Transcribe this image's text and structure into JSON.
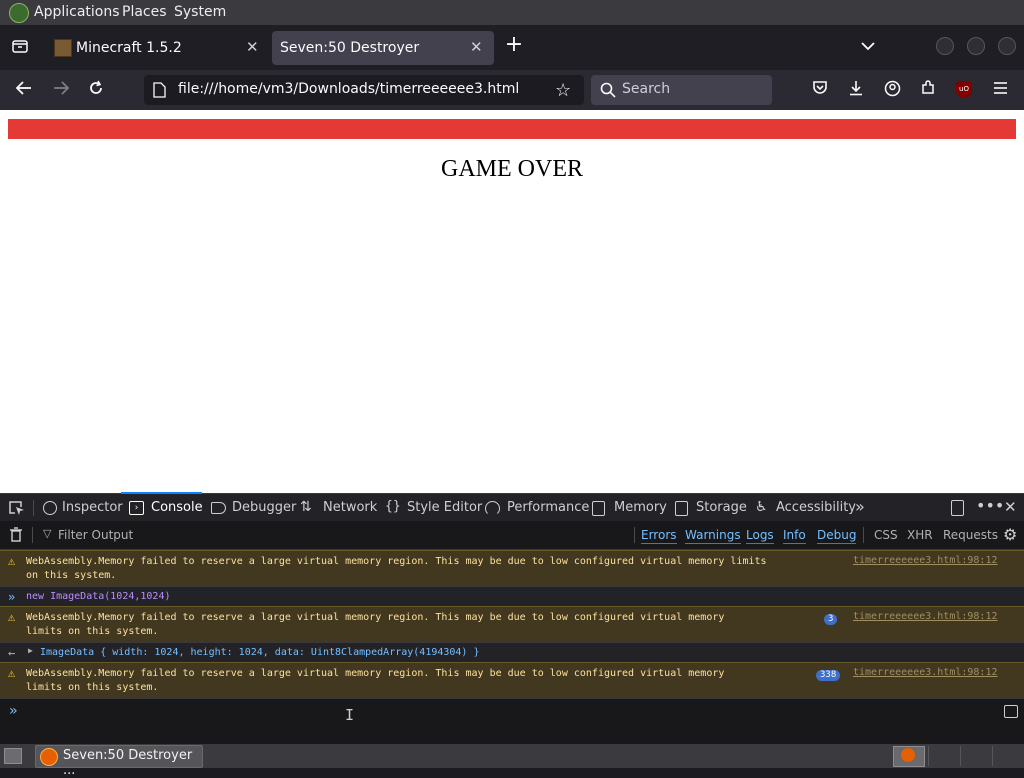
{
  "panel": {
    "applications": "Applications",
    "places": "Places",
    "system": "System"
  },
  "tabs": [
    {
      "label": "Minecraft 1.5.2"
    },
    {
      "label": "Seven:50 Destroyer"
    }
  ],
  "nav": {
    "url": "file:///home/vm3/Downloads/timerreeeeee3.html",
    "search_placeholder": "Search",
    "ublock_label": "uO"
  },
  "page": {
    "game_over": "GAME OVER",
    "bar_color": "#e53935"
  },
  "devtools": {
    "tabs": [
      {
        "label": "Inspector"
      },
      {
        "label": "Console"
      },
      {
        "label": "Debugger"
      },
      {
        "label": "Network"
      },
      {
        "label": "Style Editor"
      },
      {
        "label": "Performance"
      },
      {
        "label": "Memory"
      },
      {
        "label": "Storage"
      },
      {
        "label": "Accessibility"
      }
    ],
    "filter_placeholder": "Filter Output",
    "filters": [
      "Errors",
      "Warnings",
      "Logs",
      "Info",
      "Debug"
    ],
    "extra_filters": [
      "CSS",
      "XHR",
      "Requests"
    ],
    "messages": [
      {
        "kind": "warn",
        "text": "WebAssembly.Memory failed to reserve a large virtual memory region. This may be due to low configured virtual memory limits\non this system.",
        "source": "timerreeeeee3.html:98:12"
      },
      {
        "kind": "input",
        "text": "new ImageData(1024,1024)"
      },
      {
        "kind": "warn",
        "text": "WebAssembly.Memory failed to reserve a large virtual memory region. This may be due to low configured virtual memory\nlimits on this system.",
        "count": "3",
        "source": "timerreeeeee3.html:98:12"
      },
      {
        "kind": "result",
        "text": "ImageData { width: 1024, height: 1024, data: Uint8ClampedArray(4194304) }"
      },
      {
        "kind": "warn",
        "text": "WebAssembly.Memory failed to reserve a large virtual memory region. This may be due to low configured virtual memory\nlimits on this system.",
        "count": "338",
        "source": "timerreeeeee3.html:98:12"
      }
    ]
  },
  "taskbar": {
    "window_label": "Seven:50 Destroyer ..."
  }
}
